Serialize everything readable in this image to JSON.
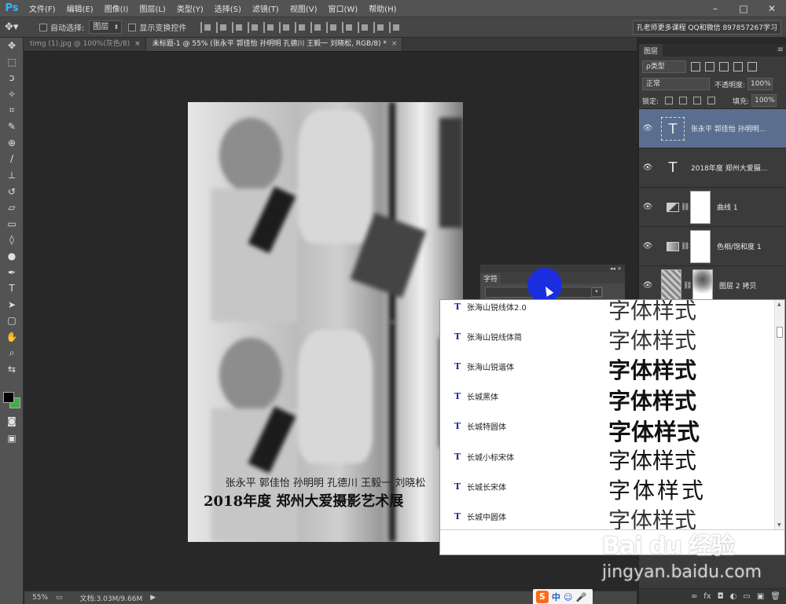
{
  "app": {
    "logo": "Ps"
  },
  "menu": [
    "文件(F)",
    "编辑(E)",
    "图像(I)",
    "图层(L)",
    "类型(Y)",
    "选择(S)",
    "滤镜(T)",
    "视图(V)",
    "窗口(W)",
    "帮助(H)"
  ],
  "window_controls": [
    "–",
    "□",
    "✕"
  ],
  "options": {
    "auto_select_label": "自动选择:",
    "auto_select_value": "图层",
    "show_transform_label": "显示变换控件",
    "workspace_label": "孔老师更多课程 QQ和微信 897857267学习"
  },
  "tabs": [
    {
      "label": "timg (1).jpg @ 100%(灰色/8)",
      "close": "×"
    },
    {
      "label": "未标题-1 @ 55% (张永平 郭佳怡 孙明明  孔德川 王毅一 刘晓松, RGB/8) *",
      "close": "×"
    }
  ],
  "canvas": {
    "names_text": "张永平 郭佳怡 孙明明 孔德川 王毅一 刘晓松",
    "title_text": "2018年度 郑州大爱摄影艺术展"
  },
  "status": {
    "zoom": "55%",
    "doc": "文档:3.03M/9.66M"
  },
  "ime": {
    "logo": "S",
    "lang": "中",
    "emoji": "☺",
    "mic": "🎤"
  },
  "layers_panel": {
    "title": "图层",
    "menu": "≡",
    "filter_kind": "ρ类型",
    "blend_mode": "正常",
    "opacity_label": "不透明度:",
    "opacity_value": "100%",
    "lock_label": "锁定:",
    "fill_label": "填充:",
    "fill_value": "100%",
    "layers": [
      {
        "name": "张永平 郭佳怡 孙明明...",
        "type": "text",
        "selected": true
      },
      {
        "name": "2018年度 郑州大爱摄...",
        "type": "text",
        "selected": false
      },
      {
        "name": "曲线 1",
        "type": "adjustment",
        "selected": false
      },
      {
        "name": "色相/饱和度 1",
        "type": "adjustment",
        "selected": false
      },
      {
        "name": "图层 2 拷贝",
        "type": "pixel",
        "selected": false
      }
    ],
    "footer_icons": [
      "∞",
      "fx",
      "◘",
      "◐",
      "▭",
      "▣",
      "🗑"
    ]
  },
  "character_panel": {
    "title": "字符",
    "close": "× ",
    "collapse": "◂◂"
  },
  "font_list": {
    "sample_text": "字体样式",
    "fonts": [
      {
        "icon": "T",
        "name": "张海山锐线体2.0",
        "weight": "normal"
      },
      {
        "icon": "T",
        "name": "张海山锐线体简",
        "weight": "normal"
      },
      {
        "icon": "T",
        "name": "张海山锐谐体",
        "weight": "bold"
      },
      {
        "icon": "T",
        "name": "长城黑体",
        "weight": "bold"
      },
      {
        "icon": "T",
        "name": "长城特圆体",
        "weight": "bold"
      },
      {
        "icon": "T",
        "name": "长城小标宋体",
        "weight": "normal"
      },
      {
        "icon": "T",
        "name": "长城长宋体",
        "weight": "normal"
      },
      {
        "icon": "T",
        "name": "长城中圆体",
        "weight": "normal"
      }
    ]
  },
  "watermark": {
    "brand": "Bai du 经验",
    "url": "jingyan.baidu.com"
  },
  "colors": {
    "accent": "#32b7ff",
    "selection": "#5a6f8f",
    "cursor": "#1a2ee0",
    "foreground": "#000000",
    "background": "#3fae49"
  }
}
